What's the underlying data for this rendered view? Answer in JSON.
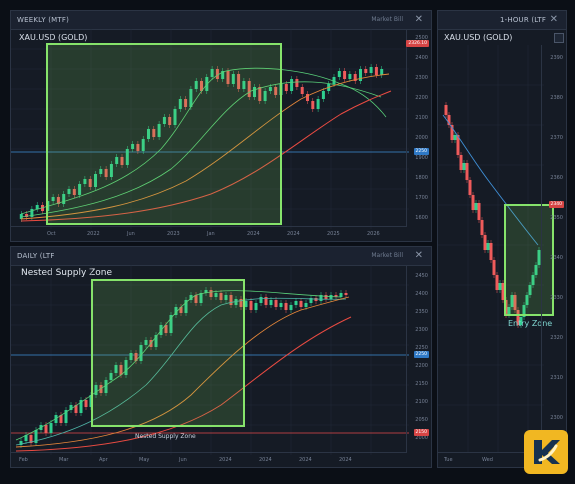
{
  "weekly": {
    "header": "WEEKLY (MTF)",
    "meta": "Market Bill",
    "close": "✕",
    "symbol": "XAU.USD (GOLD)",
    "price_tag": "2326.10",
    "mid_tag": "2250",
    "x_labels": [
      "Oct",
      "2022",
      "Jun",
      "2023",
      "Jan",
      "2024",
      "2024",
      "2025",
      "2026"
    ],
    "y_labels": [
      "2500",
      "2400",
      "2300",
      "2200",
      "2100",
      "2000",
      "1900",
      "1800",
      "1700",
      "1600"
    ]
  },
  "daily": {
    "header": "DAILY (LTF",
    "meta": "Market Bill",
    "close": "✕",
    "title": "Nested Supply Zone",
    "zone_label": "Nested Supply Zone",
    "mid_tag": "2250",
    "low_tag": "2150",
    "x_labels": [
      "Feb",
      "Mar",
      "Apr",
      "May",
      "Jun",
      "2024",
      "2024",
      "2024",
      "2024"
    ],
    "y_labels": [
      "2450",
      "2400",
      "2350",
      "2300",
      "2250",
      "2200",
      "2150",
      "2100",
      "2050",
      "2000"
    ]
  },
  "hourly": {
    "header": "1-HOUR (LTF",
    "close": "✕",
    "symbol": "XAU.USD (GOLD)",
    "entry_label": "Entry Zone",
    "price_tag": "2340",
    "x_labels": [
      "Tue",
      "Wed"
    ],
    "y_labels": [
      "2390",
      "2380",
      "2370",
      "2360",
      "2350",
      "2340",
      "2330",
      "2320",
      "2310",
      "2300"
    ]
  },
  "colors": {
    "bull": "#2fcf8f",
    "bear": "#ef5b5b",
    "zone": "#86e36b",
    "ma_green": "#59d07a",
    "ma_orange": "#e7873a",
    "ma_red": "#ea4b42",
    "ma_blue": "#3f8fd6",
    "logo": "#f1b722"
  }
}
